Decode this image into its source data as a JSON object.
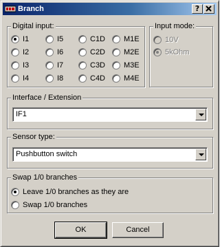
{
  "window": {
    "title": "Branch",
    "help_button": "?",
    "close_button": "X"
  },
  "digital_input": {
    "label": "Digital input:",
    "options": [
      "I1",
      "I5",
      "C1D",
      "M1E",
      "I2",
      "I6",
      "C2D",
      "M2E",
      "I3",
      "I7",
      "C3D",
      "M3E",
      "I4",
      "I8",
      "C4D",
      "M4E"
    ],
    "selected": "I1"
  },
  "input_mode": {
    "label": "Input mode:",
    "options": [
      "10V",
      "5kOhm"
    ],
    "selected": "5kOhm",
    "enabled": false
  },
  "interface": {
    "label": "Interface / Extension",
    "value": "IF1"
  },
  "sensor": {
    "label": "Sensor type:",
    "value": "Pushbutton switch"
  },
  "swap": {
    "label": "Swap 1/0 branches",
    "options": [
      "Leave 1/0 branches as they are",
      "Swap 1/0 branches"
    ],
    "selected": "Leave 1/0 branches as they are"
  },
  "buttons": {
    "ok": "OK",
    "cancel": "Cancel"
  }
}
